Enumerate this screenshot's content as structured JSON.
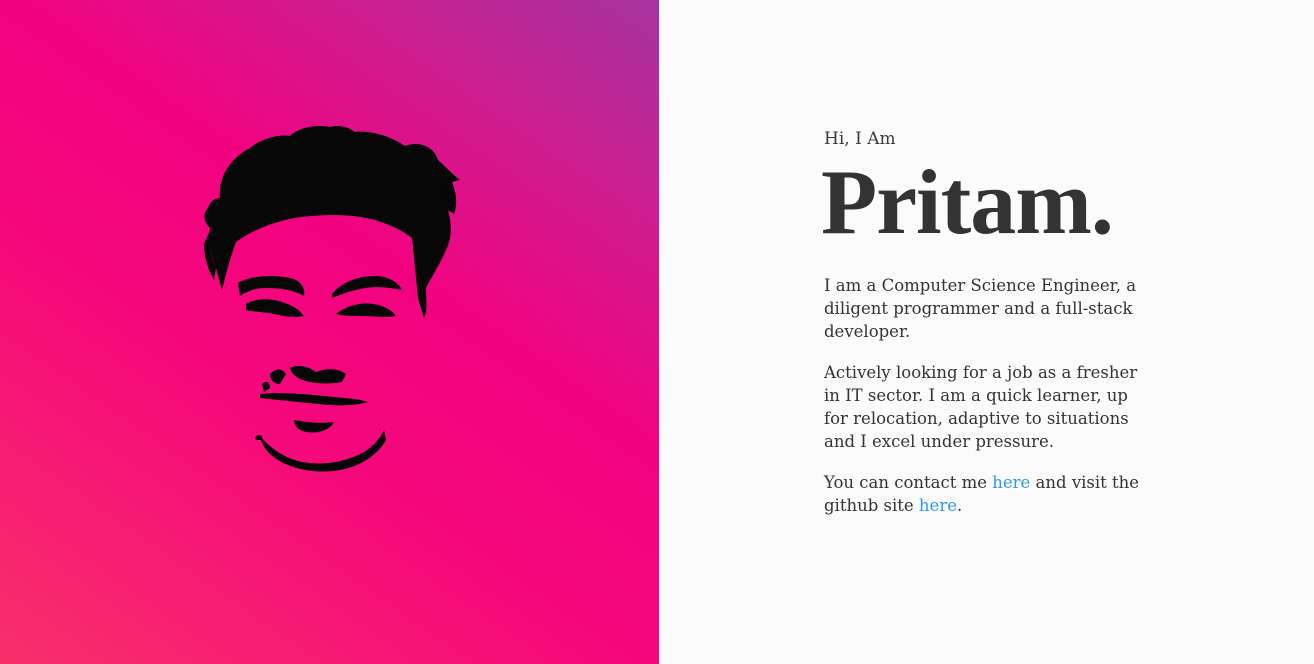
{
  "hero": {
    "greeting": "Hi, I Am",
    "name": "Pritam."
  },
  "about": {
    "paragraph_1": "I am a Computer Science Engineer, a diligent programmer and a full-stack developer.",
    "paragraph_2": "Actively looking for a job as a fresher in IT sector. I am a quick learner, up for relocation, adaptive to situations and I excel under pressure.",
    "contact_prefix": "You can contact me ",
    "contact_link": "here",
    "contact_middle": " and visit the github site ",
    "github_link": "here",
    "contact_suffix": "."
  },
  "colors": {
    "gradient_start": "#f8306a",
    "gradient_mid": "#f20280",
    "gradient_end": "#a534a0",
    "right_background": "#fbfbfb",
    "text": "#333333",
    "link": "#2b9be0"
  },
  "icons": {
    "portrait": "face-silhouette-illustration"
  }
}
